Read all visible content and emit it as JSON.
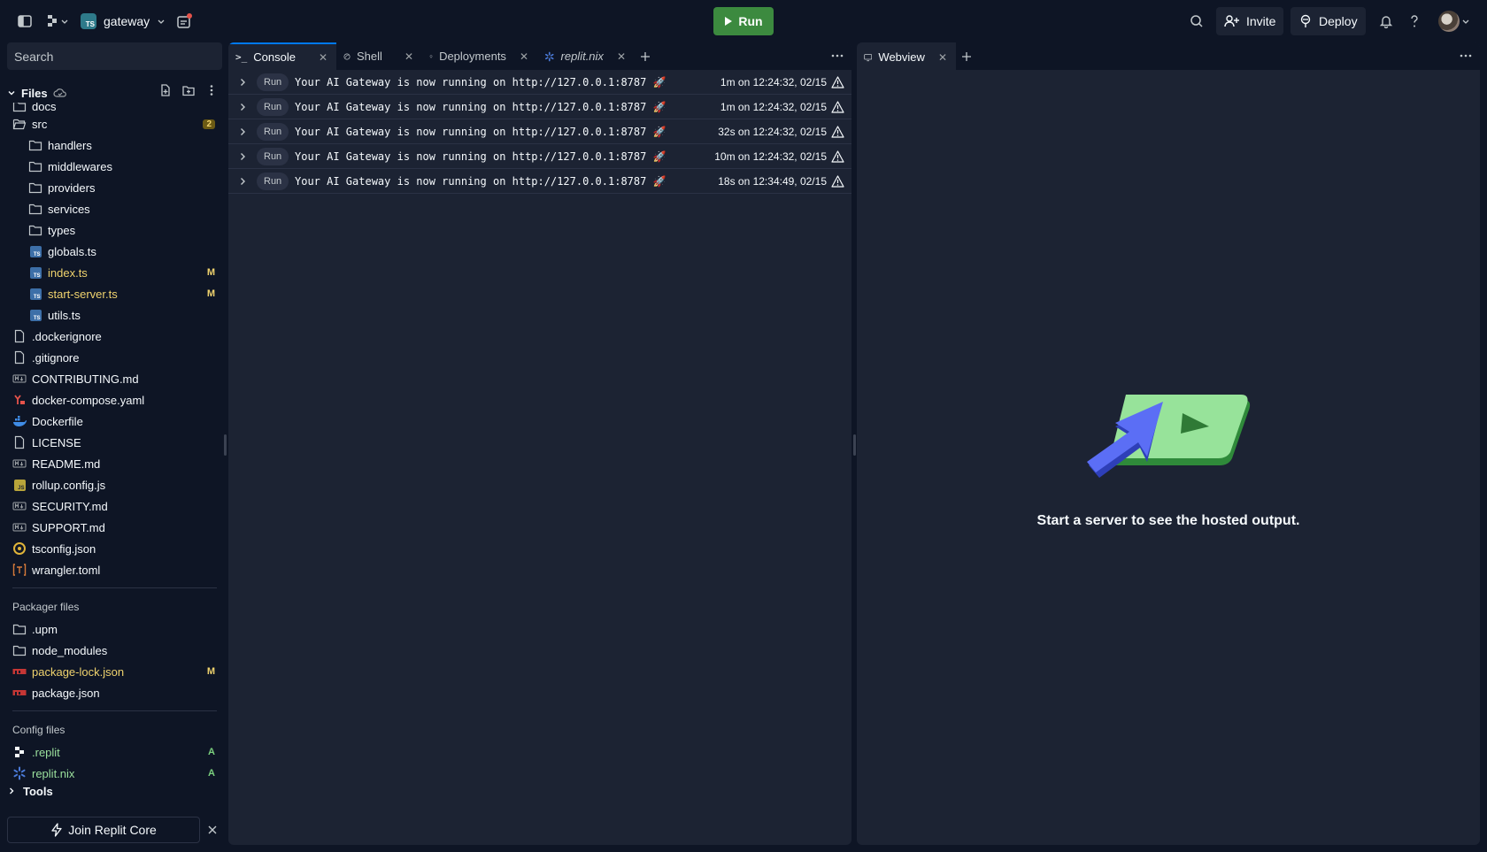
{
  "topbar": {
    "repl_name": "gateway",
    "run_label": "Run",
    "invite_label": "Invite",
    "deploy_label": "Deploy",
    "repl_lang_badge": "TS"
  },
  "sidebar": {
    "search_placeholder": "Search",
    "files_label": "Files",
    "tree": [
      {
        "name": "docs",
        "type": "folder",
        "indent": 0,
        "cut": true
      },
      {
        "name": "src",
        "type": "folder-open",
        "indent": 0,
        "badge": "2"
      },
      {
        "name": "handlers",
        "type": "folder",
        "indent": 1
      },
      {
        "name": "middlewares",
        "type": "folder",
        "indent": 1
      },
      {
        "name": "providers",
        "type": "folder",
        "indent": 1
      },
      {
        "name": "services",
        "type": "folder",
        "indent": 1
      },
      {
        "name": "types",
        "type": "folder",
        "indent": 1
      },
      {
        "name": "globals.ts",
        "type": "ts",
        "indent": 1
      },
      {
        "name": "index.ts",
        "type": "ts",
        "indent": 1,
        "badge": "M"
      },
      {
        "name": "start-server.ts",
        "type": "ts",
        "indent": 1,
        "badge": "M"
      },
      {
        "name": "utils.ts",
        "type": "ts",
        "indent": 1
      },
      {
        "name": ".dockerignore",
        "type": "file",
        "indent": 0
      },
      {
        "name": ".gitignore",
        "type": "file",
        "indent": 0
      },
      {
        "name": "CONTRIBUTING.md",
        "type": "md",
        "indent": 0
      },
      {
        "name": "docker-compose.yaml",
        "type": "yaml",
        "indent": 0
      },
      {
        "name": "Dockerfile",
        "type": "docker",
        "indent": 0
      },
      {
        "name": "LICENSE",
        "type": "file",
        "indent": 0
      },
      {
        "name": "README.md",
        "type": "md",
        "indent": 0
      },
      {
        "name": "rollup.config.js",
        "type": "js",
        "indent": 0
      },
      {
        "name": "SECURITY.md",
        "type": "md",
        "indent": 0
      },
      {
        "name": "SUPPORT.md",
        "type": "md",
        "indent": 0
      },
      {
        "name": "tsconfig.json",
        "type": "json",
        "indent": 0
      },
      {
        "name": "wrangler.toml",
        "type": "toml",
        "indent": 0
      }
    ],
    "packager_label": "Packager files",
    "packager_files": [
      {
        "name": ".upm",
        "type": "folder"
      },
      {
        "name": "node_modules",
        "type": "folder"
      },
      {
        "name": "package-lock.json",
        "type": "npm",
        "badge": "M"
      },
      {
        "name": "package.json",
        "type": "npm"
      }
    ],
    "config_label": "Config files",
    "config_files": [
      {
        "name": ".replit",
        "type": "replit",
        "badge": "A"
      },
      {
        "name": "replit.nix",
        "type": "nix",
        "badge": "A"
      }
    ],
    "tools_label": "Tools",
    "join_label": "Join Replit Core"
  },
  "console": {
    "tabs": [
      {
        "label": "Console",
        "active": true
      },
      {
        "label": "Shell"
      },
      {
        "label": "Deployments"
      },
      {
        "label": "replit.nix",
        "italic": true
      }
    ],
    "rows": [
      {
        "tag": "Run",
        "message": "Your AI Gateway is now running on http://127.0.0.1:8787 🚀",
        "time": "1m on 12:24:32, 02/15"
      },
      {
        "tag": "Run",
        "message": "Your AI Gateway is now running on http://127.0.0.1:8787 🚀",
        "time": "1m on 12:24:32, 02/15"
      },
      {
        "tag": "Run",
        "message": "Your AI Gateway is now running on http://127.0.0.1:8787 🚀",
        "time": "32s on 12:24:32, 02/15"
      },
      {
        "tag": "Run",
        "message": "Your AI Gateway is now running on http://127.0.0.1:8787 🚀",
        "time": "10m on 12:24:32, 02/15"
      },
      {
        "tag": "Run",
        "message": "Your AI Gateway is now running on http://127.0.0.1:8787 🚀",
        "time": "18s on 12:34:49, 02/15"
      }
    ]
  },
  "webview": {
    "tab_label": "Webview",
    "empty_message": "Start a server to see the hosted output."
  },
  "colors": {
    "background": "#0e1525",
    "panel": "#1c2333",
    "run_green": "#3c8a3f",
    "modified": "#f0d36e",
    "added": "#7bd07e",
    "accent": "#0079f2"
  }
}
